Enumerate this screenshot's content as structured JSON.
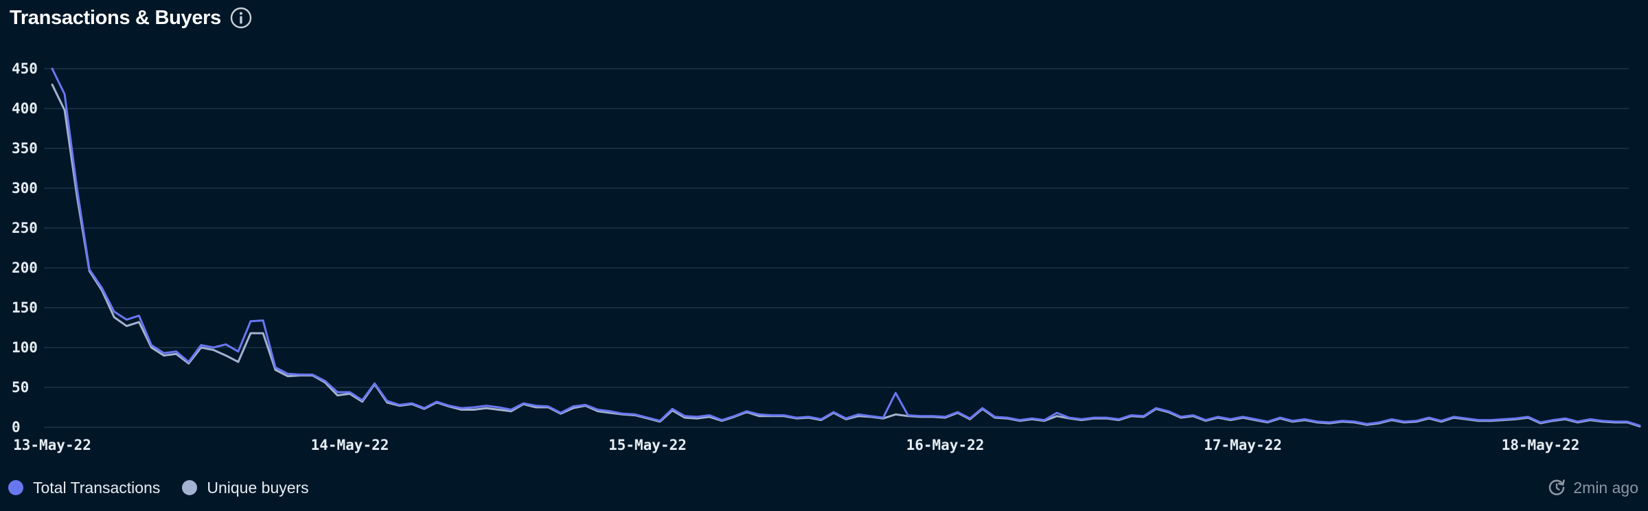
{
  "header": {
    "title": "Transactions & Buyers",
    "info_icon": "info-icon"
  },
  "footer": {
    "updated_label": "2min ago",
    "refresh_icon": "refresh-clock-icon"
  },
  "colors": {
    "background": "#011627",
    "grid": "#1d3549",
    "total_transactions": "#6877f0",
    "unique_buyers": "#a3b3d1"
  },
  "chart_data": {
    "type": "line",
    "title": "Transactions & Buyers",
    "xlabel": "",
    "ylabel": "",
    "ylim": [
      0,
      450
    ],
    "yticks": [
      0,
      50,
      100,
      150,
      200,
      250,
      300,
      350,
      400,
      450
    ],
    "xticks": [
      "13-May-22",
      "14-May-22",
      "15-May-22",
      "16-May-22",
      "17-May-22",
      "18-May-22"
    ],
    "grid": true,
    "legend_position": "bottom-left",
    "x_start": "13-May-22 00:00",
    "x_interval_hours": 1,
    "series": [
      {
        "name": "Total Transactions",
        "color": "#6877f0",
        "values": [
          450,
          418,
          300,
          198,
          175,
          145,
          135,
          140,
          103,
          93,
          95,
          82,
          103,
          100,
          104,
          95,
          133,
          134,
          75,
          67,
          66,
          66,
          58,
          44,
          44,
          34,
          55,
          33,
          28,
          30,
          24,
          32,
          27,
          24,
          25,
          27,
          25,
          22,
          30,
          27,
          26,
          18,
          26,
          28,
          22,
          20,
          17,
          16,
          12,
          8,
          23,
          14,
          13,
          15,
          9,
          14,
          20,
          16,
          15,
          15,
          12,
          13,
          10,
          19,
          11,
          16,
          14,
          12,
          43,
          15,
          14,
          14,
          13,
          19,
          11,
          24,
          13,
          12,
          9,
          11,
          9,
          18,
          12,
          10,
          12,
          12,
          10,
          15,
          14,
          24,
          20,
          13,
          15,
          9,
          13,
          10,
          13,
          10,
          7,
          12,
          8,
          10,
          7,
          6,
          8,
          7,
          4,
          6,
          10,
          7,
          8,
          12,
          8,
          13,
          11,
          9,
          9,
          10,
          11,
          13,
          6,
          9,
          11,
          7,
          10,
          8,
          7,
          7,
          2
        ],
        "ylim": [
          0,
          450
        ]
      },
      {
        "name": "Unique buyers",
        "color": "#a3b3d1",
        "values": [
          430,
          398,
          290,
          196,
          172,
          138,
          127,
          132,
          100,
          90,
          92,
          80,
          100,
          97,
          90,
          82,
          118,
          118,
          72,
          64,
          65,
          65,
          56,
          40,
          42,
          32,
          54,
          31,
          27,
          29,
          23,
          31,
          26,
          22,
          22,
          24,
          22,
          20,
          29,
          25,
          25,
          17,
          24,
          27,
          20,
          18,
          16,
          15,
          11,
          7,
          21,
          12,
          11,
          13,
          8,
          13,
          19,
          14,
          14,
          14,
          11,
          12,
          9,
          18,
          10,
          14,
          13,
          11,
          16,
          14,
          13,
          13,
          12,
          18,
          10,
          23,
          12,
          11,
          8,
          10,
          8,
          14,
          11,
          9,
          11,
          11,
          9,
          14,
          13,
          23,
          19,
          12,
          14,
          8,
          12,
          9,
          12,
          9,
          6,
          11,
          7,
          9,
          6,
          5,
          7,
          6,
          3,
          5,
          9,
          6,
          7,
          11,
          7,
          12,
          10,
          8,
          8,
          9,
          10,
          12,
          5,
          8,
          10,
          6,
          9,
          7,
          6,
          6,
          1
        ],
        "ylim": [
          0,
          450
        ]
      }
    ]
  }
}
